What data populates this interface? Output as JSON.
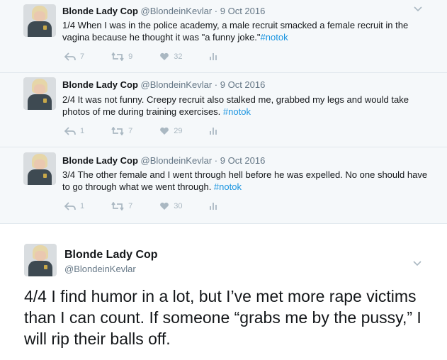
{
  "tweets": [
    {
      "name": "Blonde Lady Cop",
      "handle": "@BlondeinKevlar",
      "sep": " · ",
      "date": "9 Oct 2016",
      "text": "1/4 When I was in the police academy, a male recruit smacked a female recruit in the vagina because he thought it was \"a funny joke.\"",
      "hashtag": "#notok",
      "replies": "7",
      "retweets": "9",
      "likes": "32"
    },
    {
      "name": "Blonde Lady Cop",
      "handle": "@BlondeinKevlar",
      "sep": " · ",
      "date": "9 Oct 2016",
      "text": "2/4 It was not funny. Creepy recruit also stalked me, grabbed my legs and would take photos of me during training exercises. ",
      "hashtag": "#notok",
      "replies": "1",
      "retweets": "7",
      "likes": "29"
    },
    {
      "name": "Blonde Lady Cop",
      "handle": "@BlondeinKevlar",
      "sep": " · ",
      "date": "9 Oct 2016",
      "text": "3/4 The other female and I went through hell before he was expelled. No one should have to go through what we went through. ",
      "hashtag": "#notok",
      "replies": "1",
      "retweets": "7",
      "likes": "30"
    }
  ],
  "expanded": {
    "name": "Blonde Lady Cop",
    "handle": "@BlondeinKevlar",
    "text": "4/4 I find humor in a lot, but I’ve met more rape victims than I can count. If someone “grabs me by the pussy,” I will rip their balls off."
  },
  "icons": [
    "reply-icon",
    "retweet-icon",
    "heart-icon",
    "analytics-icon",
    "chevron-down-icon"
  ],
  "colors": {
    "background": "#f5f8fa",
    "hashtag": "#1b95e0",
    "icon": "#aab8c2",
    "text": "#14171a",
    "handle": "#657786"
  }
}
